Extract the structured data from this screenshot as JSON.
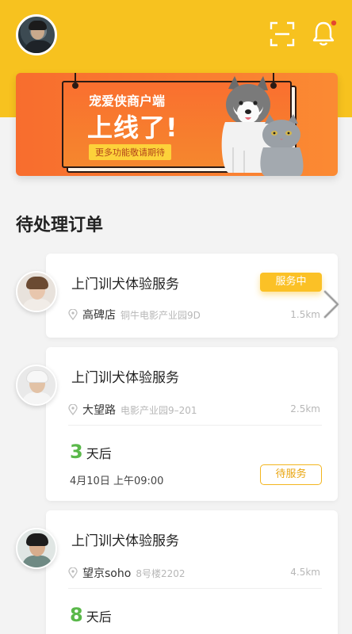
{
  "header": {
    "avatar": "user-avatar",
    "scan_icon": "scan-icon",
    "bell_icon": "bell-icon",
    "colors": {
      "brand": "#f7c21f",
      "notification_dot": "#e5462f"
    }
  },
  "banner": {
    "subtitle": "宠爱侠商户端",
    "title": "上线了!",
    "cta": "更多功能敬请期待",
    "colors": {
      "background": "#f86d2e"
    }
  },
  "section": {
    "title": "待处理订单"
  },
  "orders": [
    {
      "service": "上门训犬体验服务",
      "status": "服务中",
      "area": "高碑店",
      "address": "铜牛电影产业园9D",
      "distance": "1.5km"
    },
    {
      "service": "上门训犬体验服务",
      "area": "大望路",
      "address": "电影产业园9–201",
      "distance": "2.5km",
      "days_num": "3",
      "days_label": "天后",
      "datetime": "4月10日 上午09:00",
      "status": "待服务"
    },
    {
      "service": "上门训犬体验服务",
      "area": "望京soho",
      "address": "8号楼2202",
      "distance": "4.5km",
      "days_num": "8",
      "days_label": "天后"
    }
  ],
  "accent_colors": {
    "days_green": "#5ab84a",
    "status_yellow": "#fbc126"
  }
}
